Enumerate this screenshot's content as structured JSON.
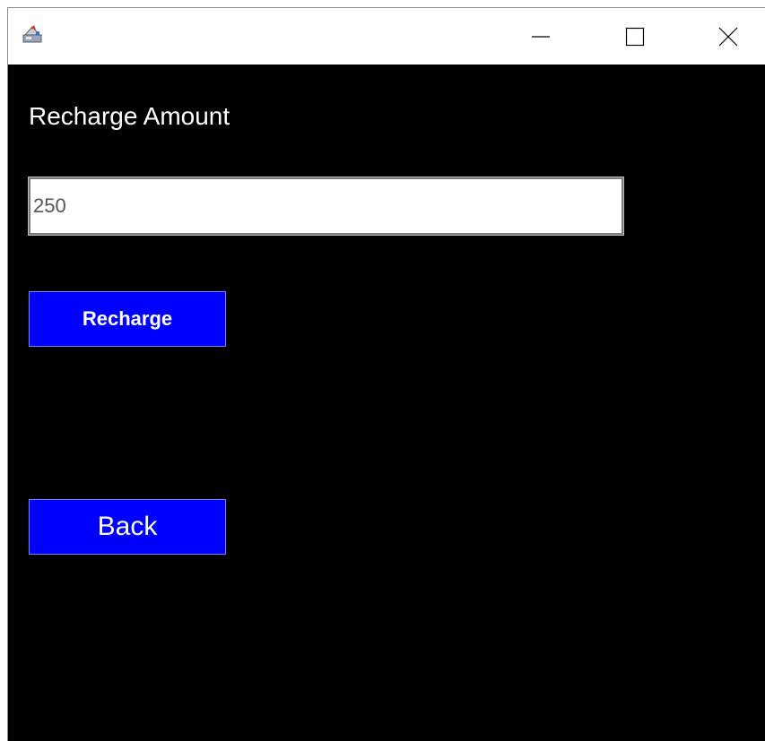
{
  "window": {
    "app_icon": "java-app-icon",
    "controls": {
      "minimize_icon": "minimize-icon",
      "maximize_icon": "maximize-icon",
      "close_icon": "close-icon"
    }
  },
  "form": {
    "amount_label": "Recharge Amount",
    "amount_value": "250",
    "recharge_button": "Recharge",
    "back_button": "Back"
  },
  "colors": {
    "background": "#000000",
    "button": "#0000ff",
    "text": "#ffffff"
  }
}
